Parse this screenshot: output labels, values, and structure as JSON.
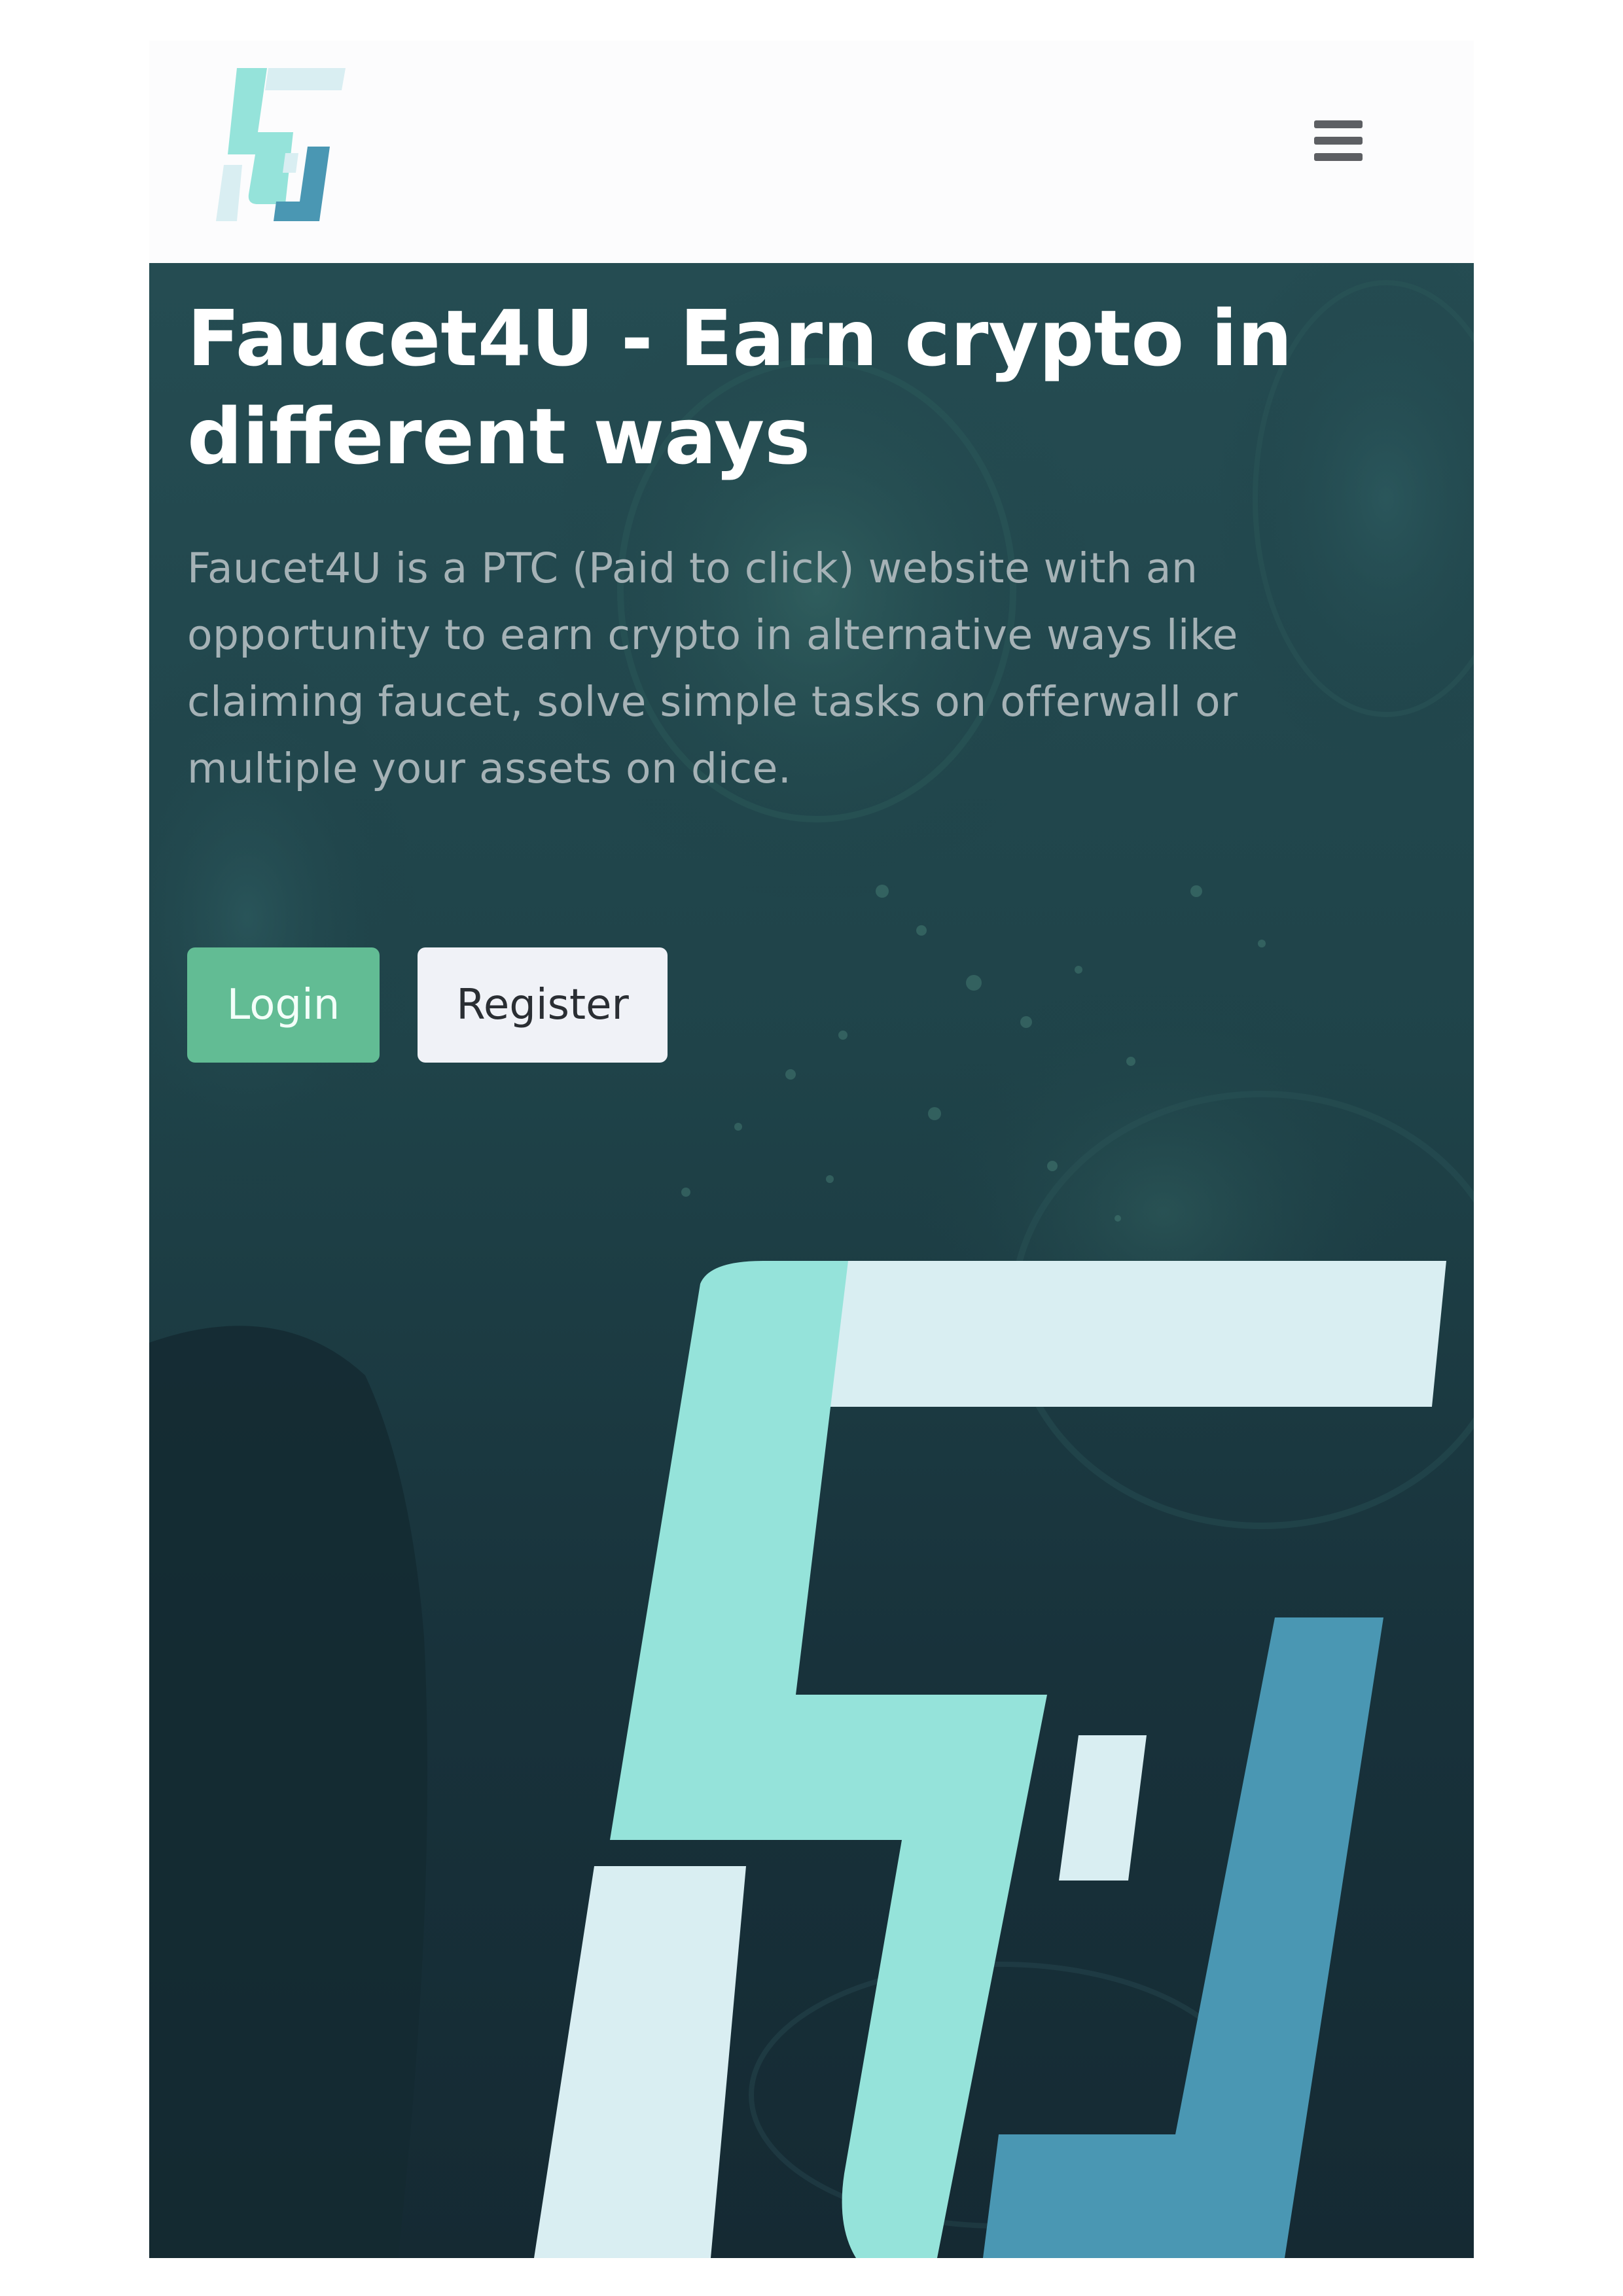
{
  "brand": {
    "logo_icon": "faucet4u-logo-icon",
    "colors": {
      "mint": "#95e3da",
      "pale": "#d9eef2",
      "teal_blue": "#4a97b3",
      "hero_bg": "#1a3b42"
    }
  },
  "nav": {
    "menu_icon": "hamburger-menu-icon"
  },
  "hero": {
    "title": "Faucet4U - Earn crypto in different ways",
    "description": "Faucet4U is a PTC (Paid to click) website with an opportunity to earn crypto in alternative ways like claiming faucet, solve simple tasks on offerwall or multiple your assets on dice.",
    "login_label": "Login",
    "register_label": "Register",
    "login_color": "#62bc94",
    "register_color": "#f0f2f7"
  }
}
